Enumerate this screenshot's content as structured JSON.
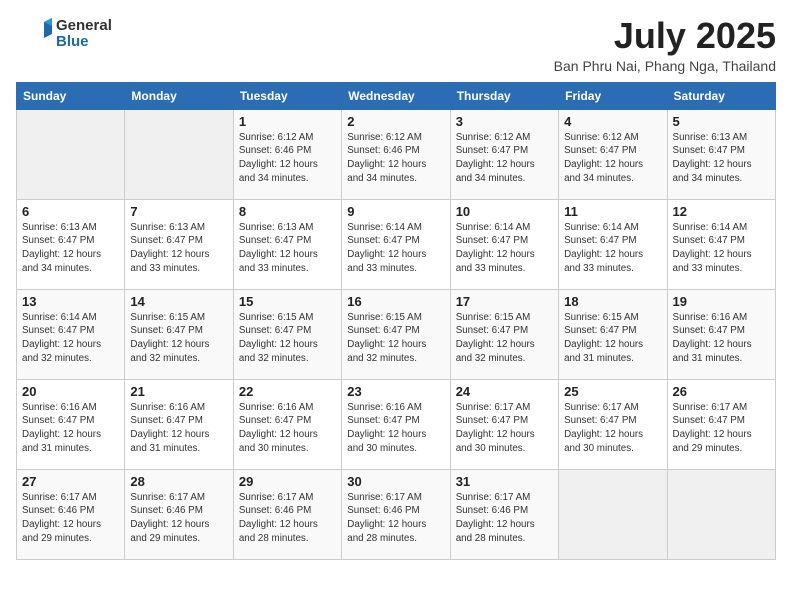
{
  "header": {
    "logo_general": "General",
    "logo_blue": "Blue",
    "month_year": "July 2025",
    "location": "Ban Phru Nai, Phang Nga, Thailand"
  },
  "days_of_week": [
    "Sunday",
    "Monday",
    "Tuesday",
    "Wednesday",
    "Thursday",
    "Friday",
    "Saturday"
  ],
  "weeks": [
    [
      {
        "day": "",
        "detail": ""
      },
      {
        "day": "",
        "detail": ""
      },
      {
        "day": "1",
        "detail": "Sunrise: 6:12 AM\nSunset: 6:46 PM\nDaylight: 12 hours and 34 minutes."
      },
      {
        "day": "2",
        "detail": "Sunrise: 6:12 AM\nSunset: 6:46 PM\nDaylight: 12 hours and 34 minutes."
      },
      {
        "day": "3",
        "detail": "Sunrise: 6:12 AM\nSunset: 6:47 PM\nDaylight: 12 hours and 34 minutes."
      },
      {
        "day": "4",
        "detail": "Sunrise: 6:12 AM\nSunset: 6:47 PM\nDaylight: 12 hours and 34 minutes."
      },
      {
        "day": "5",
        "detail": "Sunrise: 6:13 AM\nSunset: 6:47 PM\nDaylight: 12 hours and 34 minutes."
      }
    ],
    [
      {
        "day": "6",
        "detail": "Sunrise: 6:13 AM\nSunset: 6:47 PM\nDaylight: 12 hours and 34 minutes."
      },
      {
        "day": "7",
        "detail": "Sunrise: 6:13 AM\nSunset: 6:47 PM\nDaylight: 12 hours and 33 minutes."
      },
      {
        "day": "8",
        "detail": "Sunrise: 6:13 AM\nSunset: 6:47 PM\nDaylight: 12 hours and 33 minutes."
      },
      {
        "day": "9",
        "detail": "Sunrise: 6:14 AM\nSunset: 6:47 PM\nDaylight: 12 hours and 33 minutes."
      },
      {
        "day": "10",
        "detail": "Sunrise: 6:14 AM\nSunset: 6:47 PM\nDaylight: 12 hours and 33 minutes."
      },
      {
        "day": "11",
        "detail": "Sunrise: 6:14 AM\nSunset: 6:47 PM\nDaylight: 12 hours and 33 minutes."
      },
      {
        "day": "12",
        "detail": "Sunrise: 6:14 AM\nSunset: 6:47 PM\nDaylight: 12 hours and 33 minutes."
      }
    ],
    [
      {
        "day": "13",
        "detail": "Sunrise: 6:14 AM\nSunset: 6:47 PM\nDaylight: 12 hours and 32 minutes."
      },
      {
        "day": "14",
        "detail": "Sunrise: 6:15 AM\nSunset: 6:47 PM\nDaylight: 12 hours and 32 minutes."
      },
      {
        "day": "15",
        "detail": "Sunrise: 6:15 AM\nSunset: 6:47 PM\nDaylight: 12 hours and 32 minutes."
      },
      {
        "day": "16",
        "detail": "Sunrise: 6:15 AM\nSunset: 6:47 PM\nDaylight: 12 hours and 32 minutes."
      },
      {
        "day": "17",
        "detail": "Sunrise: 6:15 AM\nSunset: 6:47 PM\nDaylight: 12 hours and 32 minutes."
      },
      {
        "day": "18",
        "detail": "Sunrise: 6:15 AM\nSunset: 6:47 PM\nDaylight: 12 hours and 31 minutes."
      },
      {
        "day": "19",
        "detail": "Sunrise: 6:16 AM\nSunset: 6:47 PM\nDaylight: 12 hours and 31 minutes."
      }
    ],
    [
      {
        "day": "20",
        "detail": "Sunrise: 6:16 AM\nSunset: 6:47 PM\nDaylight: 12 hours and 31 minutes."
      },
      {
        "day": "21",
        "detail": "Sunrise: 6:16 AM\nSunset: 6:47 PM\nDaylight: 12 hours and 31 minutes."
      },
      {
        "day": "22",
        "detail": "Sunrise: 6:16 AM\nSunset: 6:47 PM\nDaylight: 12 hours and 30 minutes."
      },
      {
        "day": "23",
        "detail": "Sunrise: 6:16 AM\nSunset: 6:47 PM\nDaylight: 12 hours and 30 minutes."
      },
      {
        "day": "24",
        "detail": "Sunrise: 6:17 AM\nSunset: 6:47 PM\nDaylight: 12 hours and 30 minutes."
      },
      {
        "day": "25",
        "detail": "Sunrise: 6:17 AM\nSunset: 6:47 PM\nDaylight: 12 hours and 30 minutes."
      },
      {
        "day": "26",
        "detail": "Sunrise: 6:17 AM\nSunset: 6:47 PM\nDaylight: 12 hours and 29 minutes."
      }
    ],
    [
      {
        "day": "27",
        "detail": "Sunrise: 6:17 AM\nSunset: 6:46 PM\nDaylight: 12 hours and 29 minutes."
      },
      {
        "day": "28",
        "detail": "Sunrise: 6:17 AM\nSunset: 6:46 PM\nDaylight: 12 hours and 29 minutes."
      },
      {
        "day": "29",
        "detail": "Sunrise: 6:17 AM\nSunset: 6:46 PM\nDaylight: 12 hours and 28 minutes."
      },
      {
        "day": "30",
        "detail": "Sunrise: 6:17 AM\nSunset: 6:46 PM\nDaylight: 12 hours and 28 minutes."
      },
      {
        "day": "31",
        "detail": "Sunrise: 6:17 AM\nSunset: 6:46 PM\nDaylight: 12 hours and 28 minutes."
      },
      {
        "day": "",
        "detail": ""
      },
      {
        "day": "",
        "detail": ""
      }
    ]
  ]
}
